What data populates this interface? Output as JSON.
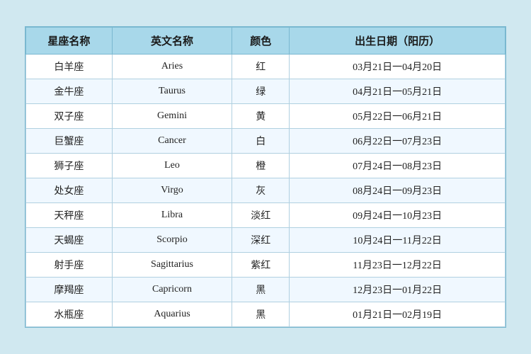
{
  "table": {
    "headers": {
      "chinese_name": "星座名称",
      "english_name": "英文名称",
      "color": "颜色",
      "birth_date": "出生日期（阳历）"
    },
    "rows": [
      {
        "chinese": "白羊座",
        "english": "Aries",
        "color": "红",
        "date": "03月21日一04月20日"
      },
      {
        "chinese": "金牛座",
        "english": "Taurus",
        "color": "绿",
        "date": "04月21日一05月21日"
      },
      {
        "chinese": "双子座",
        "english": "Gemini",
        "color": "黄",
        "date": "05月22日一06月21日"
      },
      {
        "chinese": "巨蟹座",
        "english": "Cancer",
        "color": "白",
        "date": "06月22日一07月23日"
      },
      {
        "chinese": "狮子座",
        "english": "Leo",
        "color": "橙",
        "date": "07月24日一08月23日"
      },
      {
        "chinese": "处女座",
        "english": "Virgo",
        "color": "灰",
        "date": "08月24日一09月23日"
      },
      {
        "chinese": "天秤座",
        "english": "Libra",
        "color": "淡红",
        "date": "09月24日一10月23日"
      },
      {
        "chinese": "天蝎座",
        "english": "Scorpio",
        "color": "深红",
        "date": "10月24日一11月22日"
      },
      {
        "chinese": "射手座",
        "english": "Sagittarius",
        "color": "紫红",
        "date": "11月23日一12月22日"
      },
      {
        "chinese": "摩羯座",
        "english": "Capricorn",
        "color": "黑",
        "date": "12月23日一01月22日"
      },
      {
        "chinese": "水瓶座",
        "english": "Aquarius",
        "color": "黑",
        "date": "01月21日一02月19日"
      }
    ]
  }
}
